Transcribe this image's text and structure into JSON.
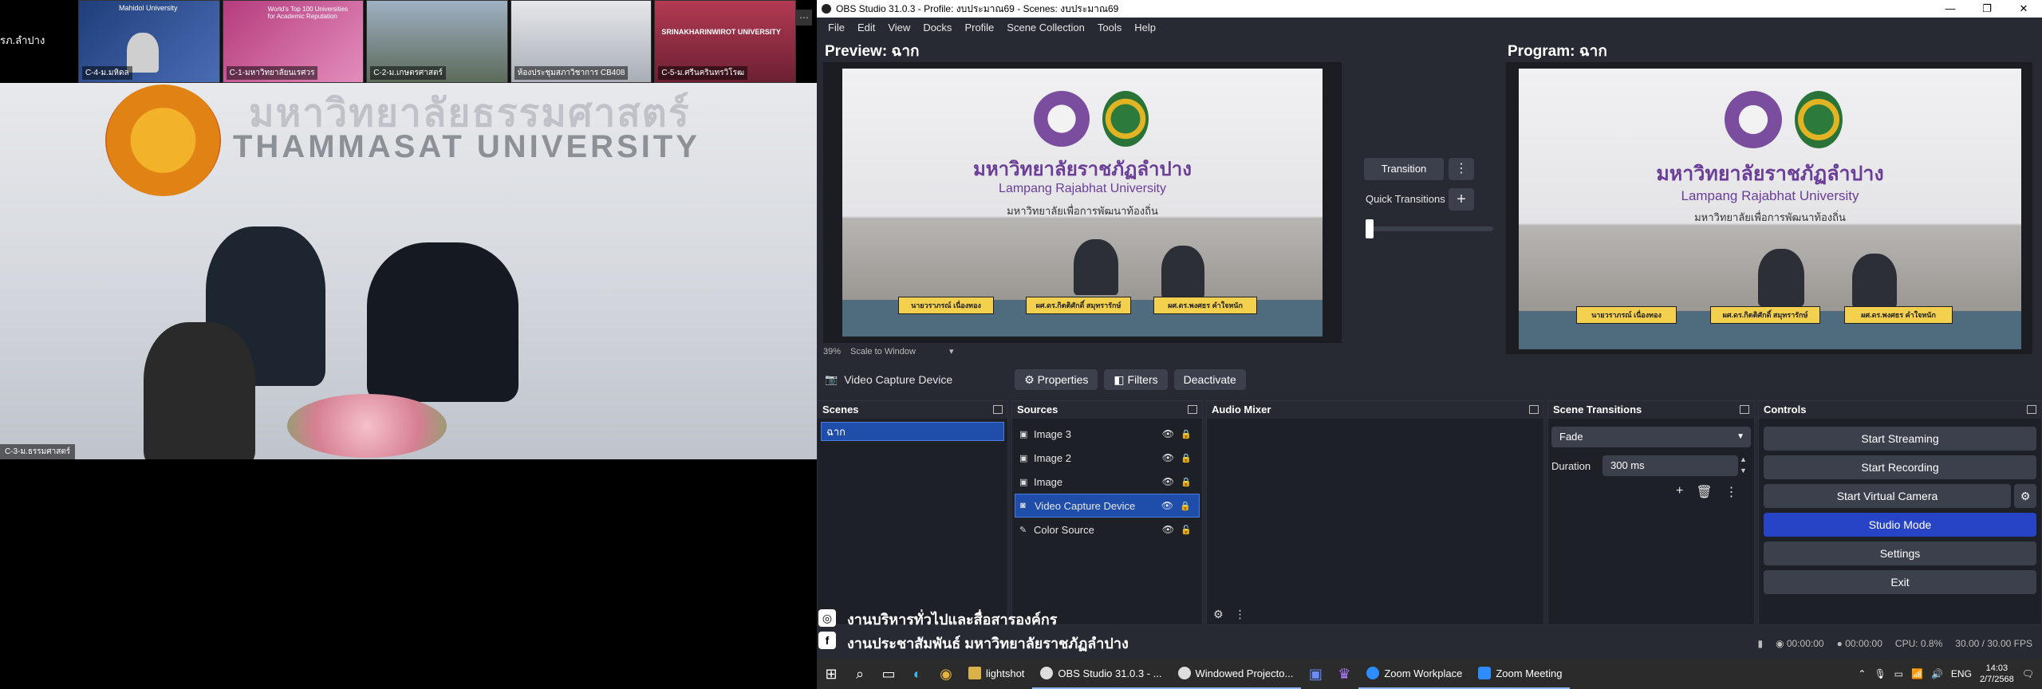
{
  "zoom": {
    "top_label": "รภ.ลำปาง",
    "gallery": [
      "C-4-ม.มหิดล",
      "C-1-มหาวิทยาลัยนเรศวร",
      "C-2-ม.เกษตรศาสตร์",
      "ห้องประชุมสภาวิชาการ CB408",
      "C-5-ม.ศรีนครินทรวิโรฒ"
    ],
    "gallery_banners": [
      "Mahidol University",
      "World's Top 100 Universities for Academic Reputation",
      "",
      "",
      "SRINAKHARINWIROT UNIVERSITY"
    ],
    "main_name": "C-3-ม.ธรรมศาสตร์",
    "sign_thai": "มหาวิทยาลัยธรรมศาสตร์",
    "sign_en": "THAMMASAT UNIVERSITY",
    "caption_line1": "งานบริหารทั่วไปและสื่อสารองค์กร",
    "caption_line2": "งานประชาสัมพันธ์ มหาวิทยาลัยราชภัฏลำปาง"
  },
  "obs": {
    "window_title": "OBS Studio 31.0.3 - Profile: งบประมาณ69 - Scenes: งบประมาณ69",
    "menu": [
      "File",
      "Edit",
      "View",
      "Docks",
      "Profile",
      "Scene Collection",
      "Tools",
      "Help"
    ],
    "preview_title": "Preview: ฉาก",
    "program_title": "Program: ฉาก",
    "scene_image": {
      "thai_title": "มหาวิทยาลัยราชภัฏลำปาง",
      "en_title": "Lampang Rajabhat University",
      "thai_sub": "มหาวิทยาลัยเพื่อการพัฒนาท้องถิ่น",
      "plates": [
        "นายวราภรณ์ เนื่องทอง",
        "ผศ.ดร.กิตติศักดิ์ สมุทรารักษ์",
        "ผศ.ดร.พงศธร คำใจหนัก"
      ]
    },
    "zoom_level": "39%",
    "scale_mode": "Scale to Window",
    "transition_label": "Transition",
    "quick_transitions_label": "Quick Transitions",
    "transition_slider": 0,
    "selected_source_name": "Video Capture Device",
    "toolbar": {
      "properties": "Properties",
      "filters": "Filters",
      "deactivate": "Deactivate"
    },
    "docks": {
      "scenes_title": "Scenes",
      "sources_title": "Sources",
      "mixer_title": "Audio Mixer",
      "transitions_title": "Scene Transitions",
      "controls_title": "Controls"
    },
    "scenes": [
      "ฉาก"
    ],
    "sources": [
      {
        "name": "Image 3",
        "icon": "image-icon"
      },
      {
        "name": "Image 2",
        "icon": "image-icon"
      },
      {
        "name": "Image",
        "icon": "image-icon"
      },
      {
        "name": "Video Capture Device",
        "icon": "camera-icon"
      },
      {
        "name": "Color Source",
        "icon": "brush-icon"
      }
    ],
    "transition_select": "Fade",
    "duration_label": "Duration",
    "duration_value": "300 ms",
    "controls": [
      "Start Streaming",
      "Start Recording",
      "Start Virtual Camera",
      "Studio Mode",
      "Settings",
      "Exit"
    ],
    "status": {
      "stream_time": "00:00:00",
      "record_time": "00:00:00",
      "cpu": "CPU: 0.8%",
      "fps": "30.00 / 30.00 FPS"
    }
  },
  "taskbar": {
    "apps": [
      "lightshot",
      "OBS Studio 31.0.3 - ...",
      "Windowed Projecto...",
      "Zoom Workplace",
      "Zoom Meeting"
    ],
    "lang": "ENG",
    "time": "14:03",
    "date": "2/7/2568"
  },
  "colors": {
    "accent": "#2744c6",
    "obs_bg": "#272a33",
    "selection": "#1f4eaa"
  }
}
